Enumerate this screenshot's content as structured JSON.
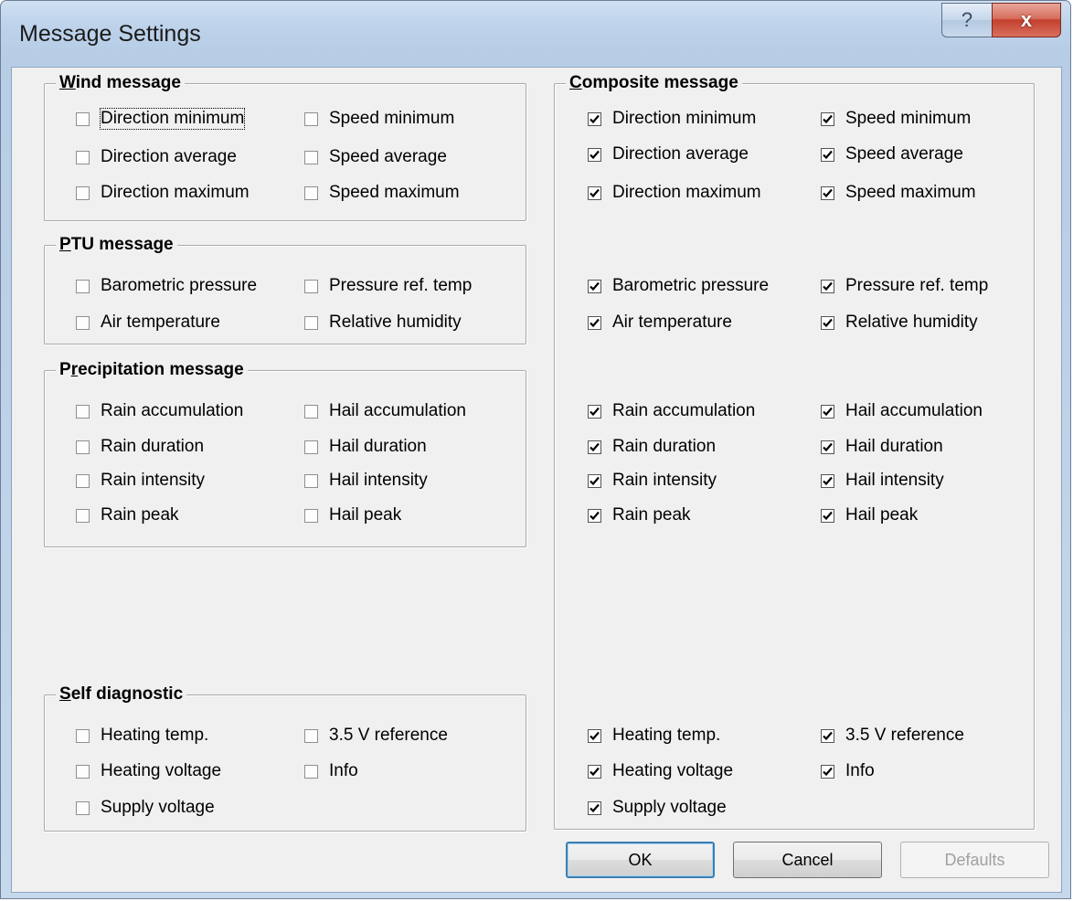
{
  "window": {
    "title": "Message Settings",
    "help_glyph": "?",
    "close_glyph": "x"
  },
  "wind": {
    "title_key": "W",
    "title_rest": "ind message",
    "items": [
      {
        "label": "Direction minimum",
        "checked": false
      },
      {
        "label": "Speed minimum",
        "checked": false
      },
      {
        "label": "Direction average",
        "checked": false
      },
      {
        "label": "Speed average",
        "checked": false
      },
      {
        "label": "Direction maximum",
        "checked": false
      },
      {
        "label": "Speed maximum",
        "checked": false
      }
    ]
  },
  "ptu": {
    "title_key": "P",
    "title_rest": "TU message",
    "items": [
      {
        "label": "Barometric pressure",
        "checked": false
      },
      {
        "label": "Pressure ref. temp",
        "checked": false
      },
      {
        "label": "Air temperature",
        "checked": false
      },
      {
        "label": "Relative humidity",
        "checked": false
      }
    ]
  },
  "precip": {
    "title_pre": "P",
    "title_key": "r",
    "title_rest": "ecipitation message",
    "items": [
      {
        "label": "Rain accumulation",
        "checked": false
      },
      {
        "label": "Hail accumulation",
        "checked": false
      },
      {
        "label": "Rain duration",
        "checked": false
      },
      {
        "label": "Hail duration",
        "checked": false
      },
      {
        "label": "Rain intensity",
        "checked": false
      },
      {
        "label": "Hail intensity",
        "checked": false
      },
      {
        "label": "Rain peak",
        "checked": false
      },
      {
        "label": "Hail peak",
        "checked": false
      }
    ]
  },
  "self": {
    "title_key": "S",
    "title_rest": "elf diagnostic",
    "items": [
      {
        "label": "Heating temp.",
        "checked": false
      },
      {
        "label": "3.5 V reference",
        "checked": false
      },
      {
        "label": "Heating voltage",
        "checked": false
      },
      {
        "label": "Info",
        "checked": false
      },
      {
        "label": "Supply voltage",
        "checked": false
      }
    ]
  },
  "composite": {
    "title_key": "C",
    "title_rest": "omposite message",
    "items": [
      {
        "label": "Direction minimum",
        "checked": true
      },
      {
        "label": "Speed minimum",
        "checked": true
      },
      {
        "label": "Direction average",
        "checked": true
      },
      {
        "label": "Speed average",
        "checked": true
      },
      {
        "label": "Direction maximum",
        "checked": true
      },
      {
        "label": "Speed maximum",
        "checked": true
      },
      {
        "label": "Barometric pressure",
        "checked": true
      },
      {
        "label": "Pressure ref. temp",
        "checked": true
      },
      {
        "label": "Air temperature",
        "checked": true
      },
      {
        "label": "Relative humidity",
        "checked": true
      },
      {
        "label": "Rain accumulation",
        "checked": true
      },
      {
        "label": "Hail accumulation",
        "checked": true
      },
      {
        "label": "Rain duration",
        "checked": true
      },
      {
        "label": "Hail duration",
        "checked": true
      },
      {
        "label": "Rain intensity",
        "checked": true
      },
      {
        "label": "Hail intensity",
        "checked": true
      },
      {
        "label": "Rain peak",
        "checked": true
      },
      {
        "label": "Hail peak",
        "checked": true
      },
      {
        "label": "Heating temp.",
        "checked": true
      },
      {
        "label": "3.5 V reference",
        "checked": true
      },
      {
        "label": "Heating voltage",
        "checked": true
      },
      {
        "label": "Info",
        "checked": true
      },
      {
        "label": "Supply voltage",
        "checked": true
      }
    ]
  },
  "buttons": {
    "ok": "OK",
    "cancel": "Cancel",
    "defaults": "Defaults"
  }
}
